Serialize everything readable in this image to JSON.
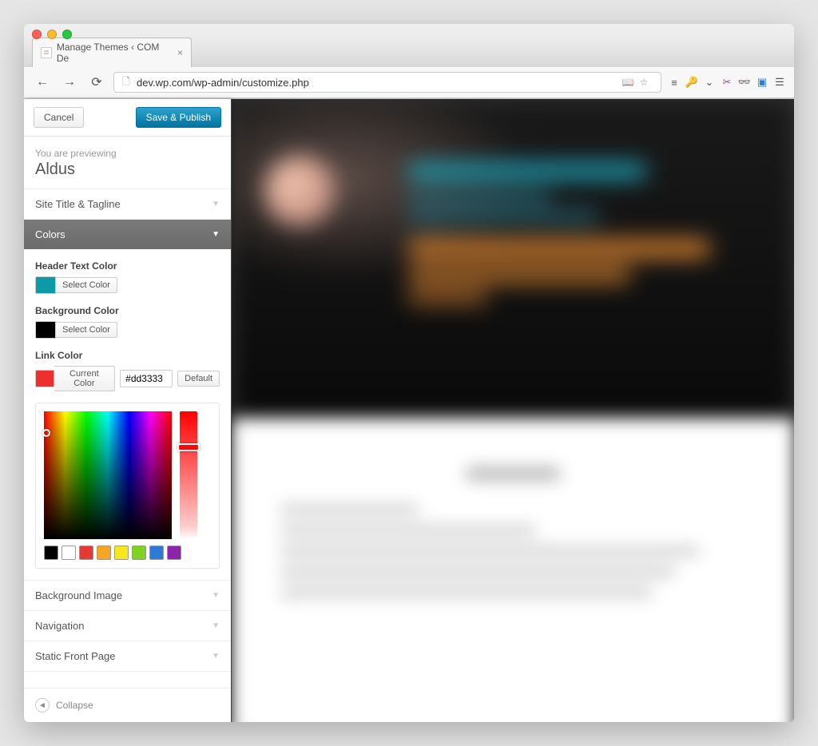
{
  "browser": {
    "tab_title": "Manage Themes ‹ COM De",
    "url": "dev.wp.com/wp-admin/customize.php"
  },
  "sidebar": {
    "cancel_label": "Cancel",
    "save_label": "Save & Publish",
    "preview_label": "You are previewing",
    "theme_name": "Aldus",
    "sections": {
      "title_tagline": "Site Title & Tagline",
      "colors": "Colors",
      "bg_image": "Background Image",
      "navigation": "Navigation",
      "front_page": "Static Front Page"
    },
    "colors_panel": {
      "header_text_label": "Header Text Color",
      "header_text_swatch": "#0b9aa6",
      "select_color_label": "Select Color",
      "background_label": "Background Color",
      "background_swatch": "#000000",
      "link_label": "Link Color",
      "link_swatch": "#ef2e2e",
      "current_color_label": "Current Color",
      "hex_value": "#dd3333",
      "default_label": "Default",
      "palette": [
        "#000000",
        "#ffffff",
        "#e53935",
        "#f5a623",
        "#f8e71c",
        "#7ed321",
        "#2e7bd6",
        "#8e24aa"
      ]
    },
    "collapse_label": "Collapse"
  }
}
